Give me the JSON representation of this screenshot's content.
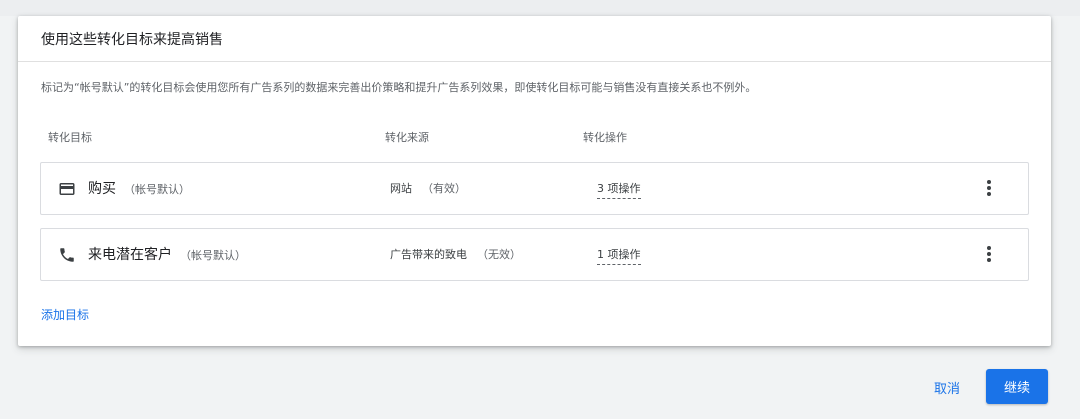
{
  "card": {
    "title": "使用这些转化目标来提高销售",
    "description": "标记为“帐号默认”的转化目标会使用您所有广告系列的数据来完善出价策略和提升广告系列效果，即使转化目标可能与销售没有直接关系也不例外。"
  },
  "columns": {
    "goal": "转化目标",
    "source": "转化来源",
    "action": "转化操作"
  },
  "rows": [
    {
      "icon": "credit-card-icon",
      "name": "购买",
      "badge": "（帐号默认）",
      "source": "网站",
      "status": "（有效）",
      "action": "3 项操作"
    },
    {
      "icon": "phone-icon",
      "name": "来电潜在客户",
      "badge": "（帐号默认）",
      "source": "广告带来的致电",
      "status": "（无效）",
      "action": "1 项操作"
    }
  ],
  "add_goal_label": "添加目标",
  "buttons": {
    "cancel": "取消",
    "continue": "继续"
  },
  "colors": {
    "accent": "#1a73e8",
    "background": "#f1f3f4"
  }
}
